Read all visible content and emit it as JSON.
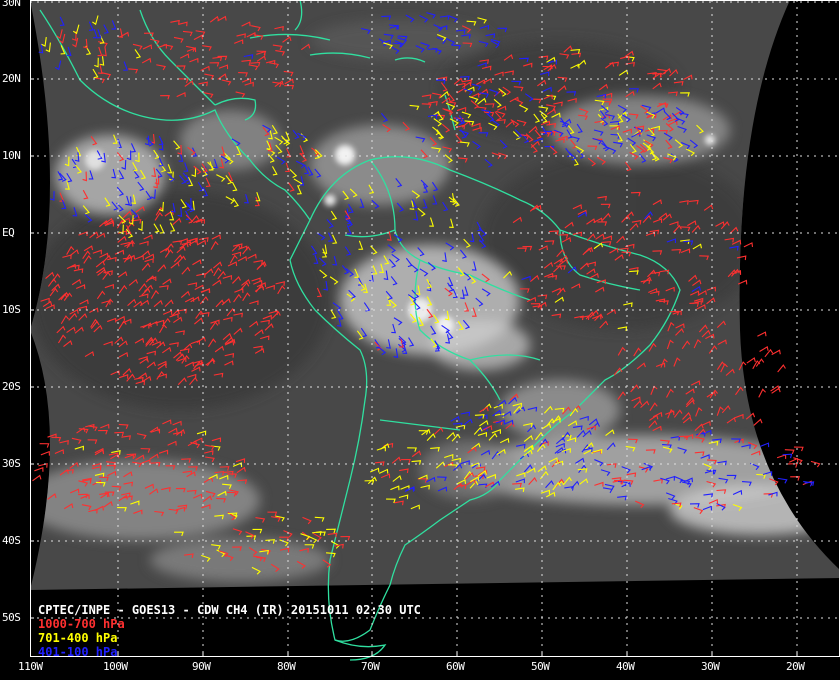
{
  "map": {
    "title": "CPTEC/INPE - GOES13 - CDW CH4 (IR) 20151011 02:30 UTC",
    "lat_labels": [
      "30N",
      "20N",
      "10N",
      "EQ",
      "10S",
      "20S",
      "30S",
      "40S",
      "50S"
    ],
    "lon_labels": [
      "110W",
      "100W",
      "90W",
      "80W",
      "70W",
      "60W",
      "50W",
      "40W",
      "30W",
      "20W"
    ],
    "legend": [
      {
        "label": "1000-700 hPa",
        "color": "#ff3030"
      },
      {
        "label": "701-400 hPa",
        "color": "#ffff00"
      },
      {
        "label": "401-100 hPa",
        "color": "#2020ff"
      }
    ],
    "colors": {
      "background": "#000000",
      "coastline": "#30e0a0",
      "grid": "#e0e0e0",
      "cloud_base": "#4a4a4a"
    }
  }
}
